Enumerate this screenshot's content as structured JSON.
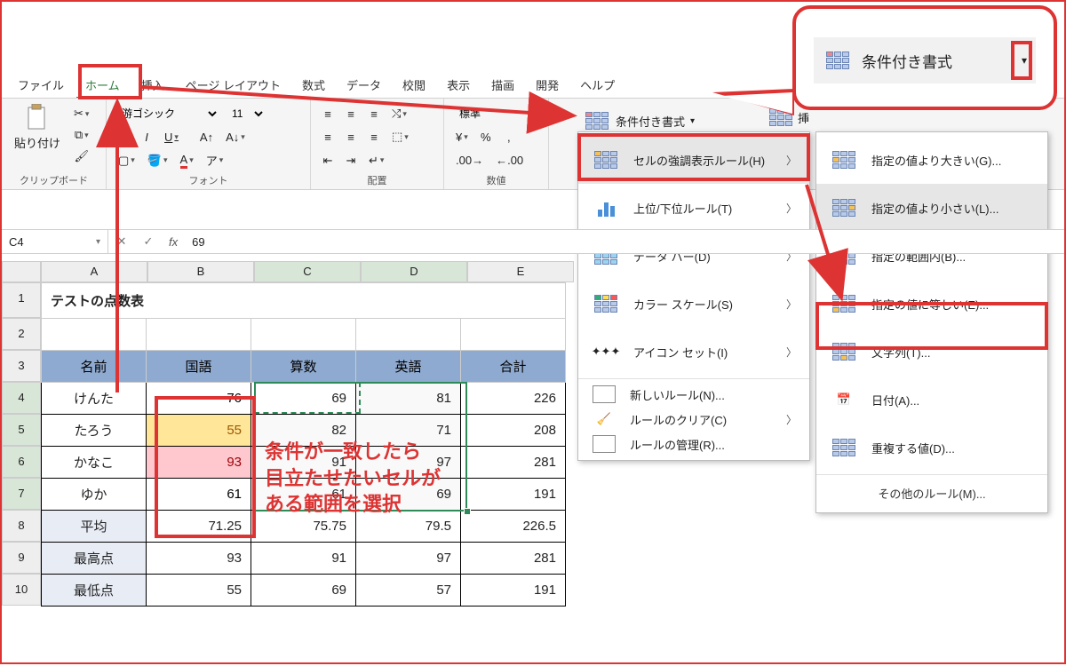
{
  "tabs": {
    "file": "ファイル",
    "home": "ホーム",
    "insert": "挿入",
    "page_layout": "ページ レイアウト",
    "formulas": "数式",
    "data": "データ",
    "review": "校閲",
    "view": "表示",
    "draw": "描画",
    "developer": "開発",
    "help": "ヘルプ"
  },
  "ribbon": {
    "paste": "貼り付け",
    "clipboard_label": "クリップボード",
    "font_name": "游ゴシック",
    "font_size": "11",
    "font_label": "フォント",
    "align_label": "配置",
    "number_format": "標準",
    "number_label": "数値",
    "cond_format": "条件付き書式",
    "insert_btn": "挿"
  },
  "callout": {
    "cond_format": "条件付き書式"
  },
  "menu1": {
    "highlight": "セルの強調表示ルール(H)",
    "topbottom": "上位/下位ルール(T)",
    "databars": "データ バー(D)",
    "colorscales": "カラー スケール(S)",
    "iconsets": "アイコン セット(I)",
    "newrule": "新しいルール(N)...",
    "clear": "ルールのクリア(C)",
    "manage": "ルールの管理(R)..."
  },
  "menu2": {
    "greater": "指定の値より大きい(G)...",
    "less": "指定の値より小さい(L)...",
    "between": "指定の範囲内(B)...",
    "equal": "指定の値に等しい(E)...",
    "text": "文字列(T)...",
    "date": "日付(A)...",
    "dup": "重複する値(D)...",
    "more": "その他のルール(M)..."
  },
  "formula_bar": {
    "name": "C4",
    "value": "69"
  },
  "columns": [
    "A",
    "B",
    "C",
    "D",
    "E"
  ],
  "rows": [
    "1",
    "2",
    "3",
    "4",
    "5",
    "6",
    "7",
    "8",
    "9",
    "10"
  ],
  "sheet": {
    "title": "テストの点数表",
    "headers": {
      "name": "名前",
      "jp": "国語",
      "math": "算数",
      "en": "英語",
      "total": "合計"
    },
    "rows": [
      {
        "name": "けんた",
        "jp": "76",
        "math": "69",
        "en": "81",
        "total": "226",
        "jp_bg": "#ffffff",
        "jp_color": "#000"
      },
      {
        "name": "たろう",
        "jp": "55",
        "math": "82",
        "en": "71",
        "total": "208",
        "jp_bg": "#ffe699",
        "jp_color": "#9c5700"
      },
      {
        "name": "かなこ",
        "jp": "93",
        "math": "91",
        "en": "97",
        "total": "281",
        "jp_bg": "#ffc7ce",
        "jp_color": "#9c0006"
      },
      {
        "name": "ゆか",
        "jp": "61",
        "math": "61",
        "en": "69",
        "total": "191",
        "jp_bg": "#ffffff",
        "jp_color": "#000"
      }
    ],
    "summary": [
      {
        "label": "平均",
        "jp": "71.25",
        "math": "75.75",
        "en": "79.5",
        "total": "226.5"
      },
      {
        "label": "最高点",
        "jp": "93",
        "math": "91",
        "en": "97",
        "total": "281"
      },
      {
        "label": "最低点",
        "jp": "55",
        "math": "69",
        "en": "57",
        "total": "191"
      }
    ]
  },
  "annotation": {
    "line1": "条件が一致したら",
    "line2": "目立たせたいセルが",
    "line3": "ある範囲を選択"
  },
  "chart_data": {
    "type": "table",
    "title": "テストの点数表",
    "columns": [
      "名前",
      "国語",
      "算数",
      "英語",
      "合計"
    ],
    "rows": [
      [
        "けんた",
        76,
        69,
        81,
        226
      ],
      [
        "たろう",
        55,
        82,
        71,
        208
      ],
      [
        "かなこ",
        93,
        91,
        97,
        281
      ],
      [
        "ゆか",
        61,
        61,
        69,
        191
      ],
      [
        "平均",
        71.25,
        75.75,
        79.5,
        226.5
      ],
      [
        "最高点",
        93,
        91,
        97,
        281
      ],
      [
        "最低点",
        55,
        69,
        57,
        191
      ]
    ]
  }
}
